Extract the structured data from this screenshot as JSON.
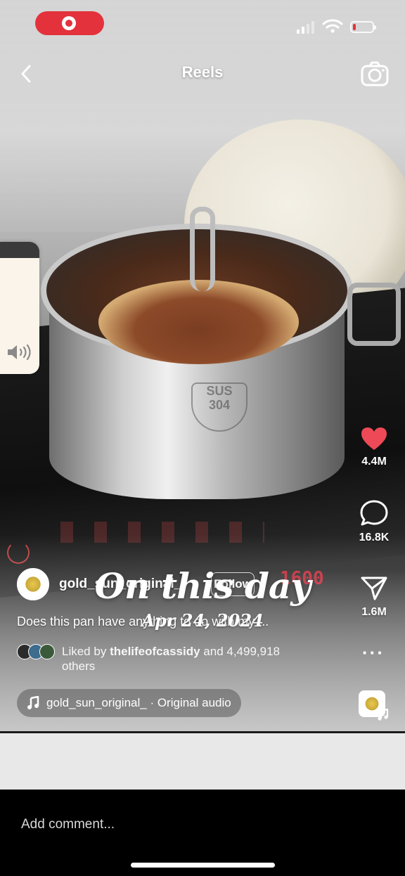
{
  "status_bar": {
    "recording": true,
    "battery_level": 0.15,
    "icons": [
      "record-icon",
      "signal-icon",
      "wifi-icon",
      "battery-icon"
    ]
  },
  "header": {
    "title": "Reels",
    "back_icon": "chevron-left-icon",
    "camera_icon": "camera-icon"
  },
  "volume": {
    "icon": "speaker-icon",
    "level": 0.88
  },
  "actions": {
    "likes": "4.4M",
    "comments": "16.8K",
    "shares": "1.6M",
    "liked": true,
    "like_color": "#ed4956"
  },
  "post": {
    "author": "gold_sun_original_",
    "follow_label": "Follow",
    "caption": "Does this pan have anything to do with my ..."
  },
  "liked_by": {
    "prefix": "Liked by",
    "user": "thelifeofcassidy",
    "suffix": "and 4,499,918 others"
  },
  "audio": {
    "label": "gold_sun_original_ · Original audio"
  },
  "memory": {
    "title": "On this day",
    "date": "Apr 24, 2024"
  },
  "comment": {
    "placeholder": "Add comment..."
  },
  "video_text": {
    "stamp_line1": "SUS",
    "stamp_line2": "304",
    "display_value": "1600"
  }
}
